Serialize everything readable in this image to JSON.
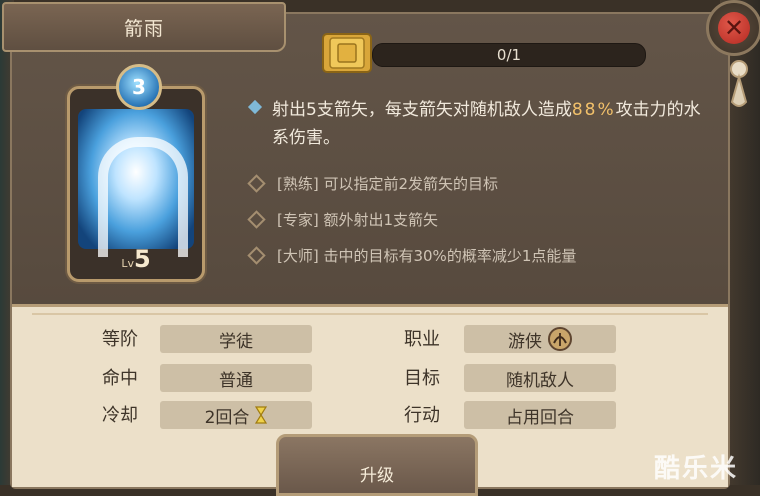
{
  "title": "箭雨",
  "progress": {
    "text": "0/1",
    "fraction": 0
  },
  "card": {
    "level_prefix": "Lv",
    "level": "5",
    "rank": "3"
  },
  "description": {
    "main_before": "射出5支箭矢，每支箭矢对随机敌人造成",
    "main_highlight": "88%",
    "main_after": "攻击力的水系伤害。",
    "subs": [
      "[熟练] 可以指定前2发箭矢的目标",
      "[专家] 额外射出1支箭矢",
      "[大师] 击中的目标有30%的概率减少1点能量"
    ]
  },
  "info": {
    "tier_label": "等阶",
    "tier_value": "学徒",
    "job_label": "职业",
    "job_value": "游侠",
    "hit_label": "命中",
    "hit_value": "普通",
    "target_label": "目标",
    "target_value": "随机敌人",
    "cooldown_label": "冷却",
    "cooldown_value": "2回合",
    "action_label": "行动",
    "action_value": "占用回合"
  },
  "upgrade_label": "升级",
  "close_label": "✕",
  "watermark": "酷乐米",
  "icons": {
    "close": "close-icon",
    "book": "book-icon",
    "ranger": "ranger-bow-icon",
    "hourglass": "hourglass-icon",
    "pin": "pin-icon"
  },
  "colors": {
    "highlight": "#f1c06a",
    "accent_blue": "#7fb9d8",
    "close_red": "#c9332a"
  }
}
